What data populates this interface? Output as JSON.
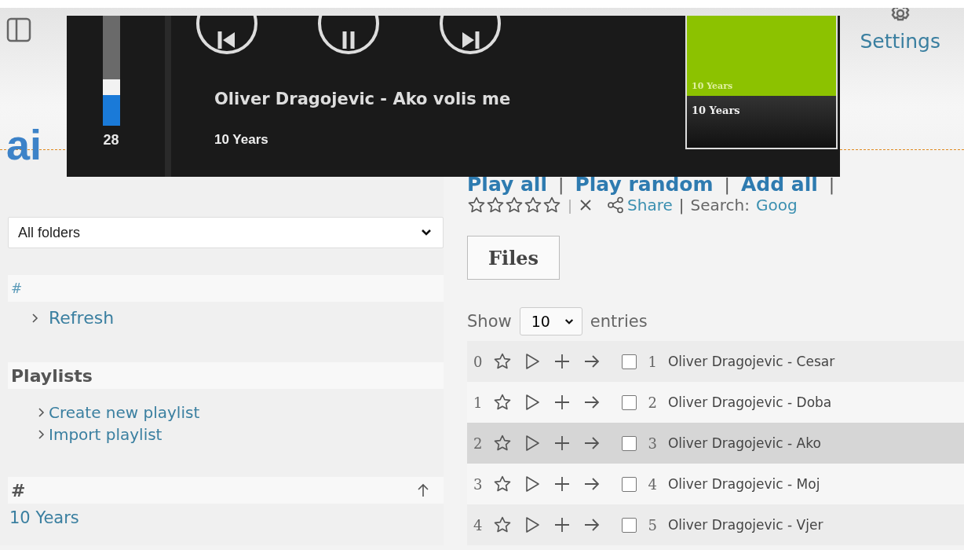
{
  "header": {
    "logo": "ai",
    "settings": {
      "label": "Settings"
    }
  },
  "player": {
    "volume": {
      "level": 0.28,
      "reading": "28"
    },
    "controls": [
      {
        "kind": "previous"
      },
      {
        "kind": "pause"
      },
      {
        "kind": "next"
      }
    ],
    "title": "Oliver Dragojevic - Ako volis me",
    "album": "10 Years",
    "cover": {
      "caption": "10 Years",
      "label": "10 Years"
    }
  },
  "sidebar": {
    "folder_select": {
      "value": "All folders"
    },
    "index_heading": "#",
    "actions": [
      {
        "label": "Refresh"
      }
    ],
    "playlists": {
      "heading": "Playlists",
      "items": [
        {
          "label": "Create new playlist"
        },
        {
          "label": "Import playlist"
        }
      ]
    },
    "artists": {
      "heading": "#",
      "entries": [
        {
          "label": "10 Years"
        }
      ]
    }
  },
  "content": {
    "actions": [
      {
        "kind": "link",
        "text": "Play all"
      },
      {
        "kind": "separator",
        "text": "|"
      },
      {
        "kind": "link",
        "text": "Play random"
      },
      {
        "kind": "separator",
        "text": "|"
      },
      {
        "kind": "link",
        "text": "Add all"
      },
      {
        "kind": "separator",
        "text": "|"
      }
    ],
    "rating": {
      "stars": 0,
      "separator_1": "|",
      "share": "Share",
      "separator_2": "|",
      "search_label": "Search:",
      "search_link": "Goog"
    },
    "tabs": [
      {
        "label": "Files",
        "selected": true
      }
    ],
    "page_size": {
      "before": "Show",
      "value": "10",
      "after": "entries"
    },
    "rows": [
      {
        "index": "0",
        "number": "1",
        "title": "Oliver Dragojevic - Cesar",
        "checked": false,
        "selected": false
      },
      {
        "index": "1",
        "number": "2",
        "title": "Oliver Dragojevic - Doba",
        "checked": false,
        "selected": false
      },
      {
        "index": "2",
        "number": "3",
        "title": "Oliver Dragojevic - Ako",
        "checked": false,
        "selected": true
      },
      {
        "index": "3",
        "number": "4",
        "title": "Oliver Dragojevic - Moj",
        "checked": false,
        "selected": false
      },
      {
        "index": "4",
        "number": "5",
        "title": "Oliver Dragojevic - Vjer",
        "checked": false,
        "selected": false
      }
    ]
  }
}
